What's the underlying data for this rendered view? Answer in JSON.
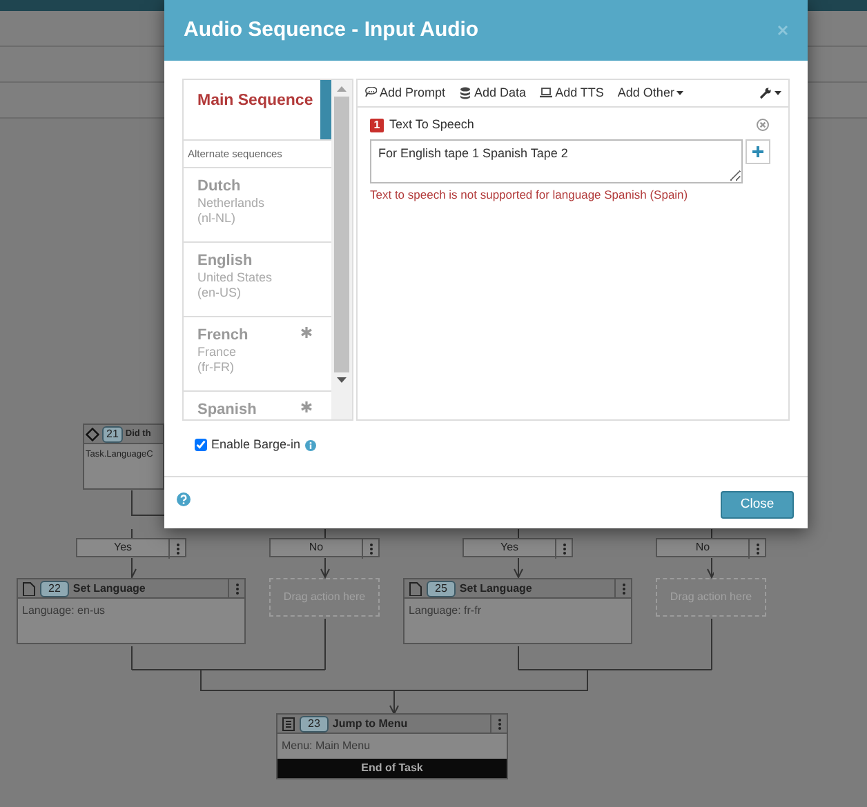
{
  "modal": {
    "title": "Audio Sequence - Input Audio",
    "main_sequence": {
      "label": "Main Sequence",
      "selected": true
    },
    "alternate_heading": "Alternate sequences",
    "sequences": [
      {
        "language": "Dutch",
        "region": "Netherlands",
        "code": "(nl-NL)",
        "starred": false,
        "selected": false
      },
      {
        "language": "English",
        "region": "United States",
        "code": "(en-US)",
        "starred": false,
        "selected": false
      },
      {
        "language": "French",
        "region": "France",
        "code": "(fr-FR)",
        "starred": true,
        "selected": false
      },
      {
        "language": "Spanish",
        "starred": true,
        "selected": false
      }
    ],
    "toolbar": [
      {
        "label": "Add Prompt",
        "kind": "prompt"
      },
      {
        "label": "Add Data",
        "kind": "data"
      },
      {
        "label": "Add TTS",
        "kind": "tts"
      },
      {
        "label": "Add Other",
        "kind": "dropdown"
      },
      {
        "kind": "settings"
      }
    ],
    "actions": [
      {
        "number": "1",
        "title": "Text To Speech",
        "value": "For English tape 1 Spanish Tape 2",
        "error": "Text to speech is not supported for language Spanish (Spain)"
      }
    ],
    "barge_in": {
      "label": "Enable Barge-in",
      "checked": true
    },
    "close_button": "Close"
  },
  "flow": {
    "decision": {
      "number": "21",
      "title": "Did th",
      "body": "Task.LanguageC"
    },
    "branches": [
      {
        "label": "Yes",
        "action": {
          "kind": "node",
          "number": "22",
          "title": "Set Language",
          "body": "Language: en-us"
        }
      },
      {
        "label": "No",
        "action": {
          "kind": "placeholder",
          "text": "Drag action here"
        }
      },
      {
        "label": "Yes",
        "action": {
          "kind": "node",
          "number": "25",
          "title": "Set Language",
          "body": "Language: fr-fr"
        }
      },
      {
        "label": "No",
        "action": {
          "kind": "placeholder",
          "text": "Drag action here"
        }
      }
    ],
    "final": {
      "number": "23",
      "title": "Jump to Menu",
      "body": "Menu: Main Menu",
      "footer": "End of Task"
    }
  }
}
